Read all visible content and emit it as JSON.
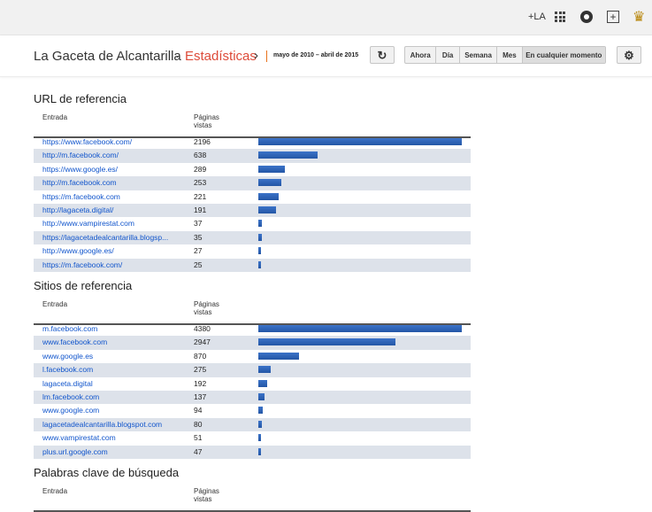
{
  "topbar": {
    "plus_label": "+LA",
    "icons": [
      "apps-icon",
      "notifications-icon",
      "share-icon",
      "avatar-icon"
    ]
  },
  "header": {
    "blog_title": "La Gaceta de Alcantarilla",
    "separator": "·",
    "page_title": "Estadísticas",
    "chevron": "›",
    "date_range": "mayo de 2010 – abril de 2015",
    "refresh_icon": "↻",
    "ranges": [
      "Ahora",
      "Día",
      "Semana",
      "Mes",
      "En cualquier momento"
    ],
    "selected_range": "En cualquier momento",
    "settings_icon": "⚙"
  },
  "tables": [
    {
      "title": "URL de referencia",
      "col_entry": "Entrada",
      "col_views": "Páginas vistas",
      "rows": [
        {
          "label": "https://www.facebook.com/",
          "value": 2196
        },
        {
          "label": "http://m.facebook.com/",
          "value": 638
        },
        {
          "label": "https://www.google.es/",
          "value": 289
        },
        {
          "label": "http://m.facebook.com",
          "value": 253
        },
        {
          "label": "https://m.facebook.com",
          "value": 221
        },
        {
          "label": "http://lagaceta.digital/",
          "value": 191
        },
        {
          "label": "http://www.vampirestat.com",
          "value": 37
        },
        {
          "label": "https://lagacetadealcantarilla.blogsp...",
          "value": 35
        },
        {
          "label": "http://www.google.es/",
          "value": 27
        },
        {
          "label": "https://m.facebook.com/",
          "value": 25
        }
      ]
    },
    {
      "title": "Sitios de referencia",
      "col_entry": "Entrada",
      "col_views": "Páginas vistas",
      "rows": [
        {
          "label": "m.facebook.com",
          "value": 4380
        },
        {
          "label": "www.facebook.com",
          "value": 2947
        },
        {
          "label": "www.google.es",
          "value": 870
        },
        {
          "label": "l.facebook.com",
          "value": 275
        },
        {
          "label": "lagaceta.digital",
          "value": 192
        },
        {
          "label": "lm.facebook.com",
          "value": 137
        },
        {
          "label": "www.google.com",
          "value": 94
        },
        {
          "label": "lagacetadealcantarilla.blogspot.com",
          "value": 80
        },
        {
          "label": "www.vampirestat.com",
          "value": 51
        },
        {
          "label": "plus.url.google.com",
          "value": 47
        }
      ]
    },
    {
      "title": "Palabras clave de búsqueda",
      "col_entry": "Entrada",
      "col_views": "Páginas vistas",
      "rows": []
    }
  ],
  "colors": {
    "accent": "#dd4b39",
    "bar": "#3366cc",
    "alt_row": "#dde2ea"
  }
}
